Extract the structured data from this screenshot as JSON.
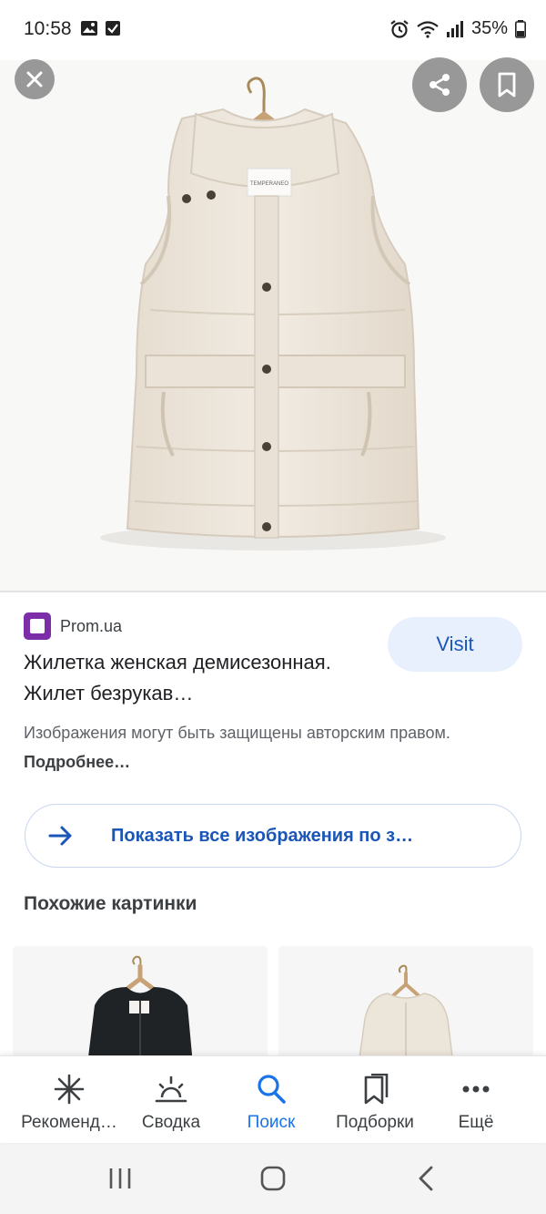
{
  "status_bar": {
    "time": "10:58",
    "battery": "35%"
  },
  "hero": {
    "close_icon": "close-icon",
    "share_icon": "share-icon",
    "bookmark_icon": "bookmark-icon",
    "label_text": "TEMPERANEO"
  },
  "result": {
    "source_name": "Prom.ua",
    "visit_label": "Visit",
    "title": "Жилетка женская демисезонная. Жилет безрукав…",
    "copyright_text": "Изображения могут быть защищены авторским правом.",
    "more_link": "Подробнее…",
    "show_all_label": "Показать все изображения по з…"
  },
  "similar": {
    "title": "Похожие картинки"
  },
  "bottom_nav": {
    "items": [
      {
        "label": "Рекоменд…",
        "icon": "asterisk-icon"
      },
      {
        "label": "Сводка",
        "icon": "sunrise-icon"
      },
      {
        "label": "Поиск",
        "icon": "search-icon"
      },
      {
        "label": "Подборки",
        "icon": "collections-icon"
      },
      {
        "label": "Ещё",
        "icon": "more-icon"
      }
    ],
    "active_index": 2
  },
  "colors": {
    "accent": "#1a73e8",
    "link": "#1a56b8",
    "visit_bg": "#e8f0fe",
    "source_logo": "#7b2ea8"
  }
}
